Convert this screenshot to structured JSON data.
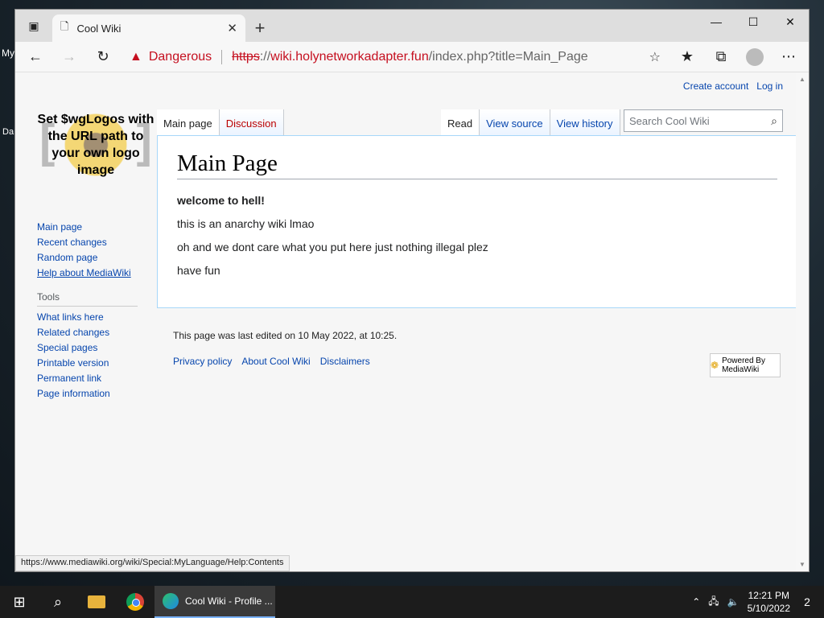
{
  "desktop": {
    "left_glyph_1": "My",
    "left_glyph_2": "Da"
  },
  "browser": {
    "tab": {
      "title": "Cool Wiki",
      "close": "✕"
    },
    "window_controls": {
      "minimize": "—",
      "maximize": "☐",
      "close": "✕"
    },
    "address": {
      "security_label": "Dangerous",
      "url_scheme": "https",
      "url_sep": "://",
      "url_host": "wiki.holynetworkadapter.fun",
      "url_path": "/index.php?title=Main_Page"
    },
    "status_url": "https://www.mediawiki.org/wiki/Special:MyLanguage/Help:Contents"
  },
  "wiki": {
    "logo_text": "Set $wgLogos with the URL path to your own logo image",
    "personal": {
      "create_account": "Create account",
      "log_in": "Log in"
    },
    "tabs": {
      "main_page": "Main page",
      "discussion": "Discussion",
      "read": "Read",
      "view_source": "View source",
      "view_history": "View history"
    },
    "search": {
      "placeholder": "Search Cool Wiki"
    },
    "nav": [
      {
        "label": "Main page"
      },
      {
        "label": "Recent changes"
      },
      {
        "label": "Random page"
      },
      {
        "label": "Help about MediaWiki"
      }
    ],
    "tools_heading": "Tools",
    "tools": [
      {
        "label": "What links here"
      },
      {
        "label": "Related changes"
      },
      {
        "label": "Special pages"
      },
      {
        "label": "Printable version"
      },
      {
        "label": "Permanent link"
      },
      {
        "label": "Page information"
      }
    ],
    "content": {
      "title": "Main Page",
      "paragraphs": [
        "welcome to hell!",
        "this is an anarchy wiki lmao",
        "oh and we dont care what you put here just nothing illegal plez",
        "have fun"
      ]
    },
    "footer": {
      "last_edited": "This page was last edited on 10 May 2022, at 10:25.",
      "links": [
        "Privacy policy",
        "About Cool Wiki",
        "Disclaimers"
      ],
      "powered_by": "Powered By MediaWiki"
    }
  },
  "taskbar": {
    "active_app": "Cool Wiki - Profile ...",
    "time": "12:21 PM",
    "date": "5/10/2022",
    "notifications": "2"
  }
}
